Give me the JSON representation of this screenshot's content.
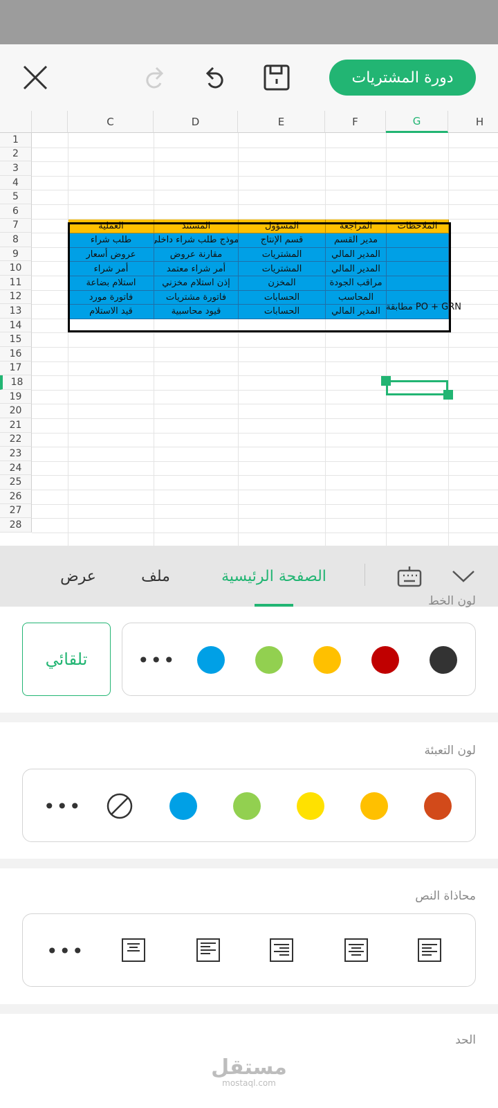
{
  "app": {
    "document_title": "دورة المشتريات"
  },
  "toolbar": {
    "close_icon": "close-icon",
    "redo_icon": "redo-icon",
    "undo_icon": "undo-icon",
    "save_icon": "save-icon"
  },
  "sheet": {
    "columns": [
      "C",
      "D",
      "E",
      "F",
      "G",
      "H"
    ],
    "active_column": "G",
    "rows": [
      "1",
      "2",
      "3",
      "4",
      "5",
      "6",
      "7",
      "8",
      "9",
      "10",
      "11",
      "12",
      "13",
      "14",
      "15",
      "16",
      "17",
      "18",
      "19",
      "20",
      "21",
      "22",
      "23",
      "24",
      "25",
      "26",
      "27",
      "28"
    ],
    "active_row": "18",
    "table_header": [
      "العملية",
      "المستند",
      "المسؤول",
      "المراجعة",
      "الملاحظات"
    ],
    "table_rows": [
      [
        "طلب شراء",
        "نموذج طلب شراء داخلي",
        "قسم الإنتاج",
        "مدير القسم",
        ""
      ],
      [
        "عروض أسعار",
        "مقارنة عروض",
        "المشتريات",
        "المدير المالي",
        ""
      ],
      [
        "أمر شراء",
        "أمر شراء معتمد",
        "المشتريات",
        "المدير المالي",
        ""
      ],
      [
        "استلام بضاعة",
        "إذن استلام مخزني",
        "المخزن",
        "مراقب الجودة",
        ""
      ],
      [
        "فاتورة مورد",
        "فاتورة مشتريات",
        "الحسابات",
        "المحاسب",
        ""
      ],
      [
        "قيد الاستلام",
        "قيود محاسبية",
        "الحسابات",
        "المدير المالي",
        ""
      ]
    ],
    "overflow_note": "مطابقة PO + GRN",
    "colors": {
      "header_fill": "#ffc000",
      "body_fill": "#00a0e6",
      "selection": "#22b573"
    }
  },
  "tabs": {
    "view": "عرض",
    "file": "ملف",
    "home": "الصفحة الرئيسية",
    "active": "home",
    "keyboard_icon": "keyboard-icon",
    "collapse_icon": "chevron-down-icon"
  },
  "format_panel": {
    "font_color": {
      "label": "لون الخط",
      "auto_label": "تلقائي",
      "swatches": [
        "#333333",
        "#c00000",
        "#ffc000",
        "#92d050",
        "#00a0e6"
      ],
      "more": "•••"
    },
    "fill_color": {
      "label": "لون التعبئة",
      "swatches": [
        "#d24a1a",
        "#ffc000",
        "#ffe100",
        "#92d050",
        "#00a0e6"
      ],
      "no_fill_icon": "no-fill-icon",
      "more": "•••"
    },
    "text_alignment": {
      "label": "محاذاة النص",
      "icons": [
        "align-left-icon",
        "align-center-icon",
        "align-right-icon",
        "align-top-icon",
        "align-middle-icon"
      ],
      "more": "•••"
    },
    "next_section_label": "الحد"
  },
  "watermark": {
    "logo_text": "مستقل",
    "sub_text": "mostaql.com"
  }
}
